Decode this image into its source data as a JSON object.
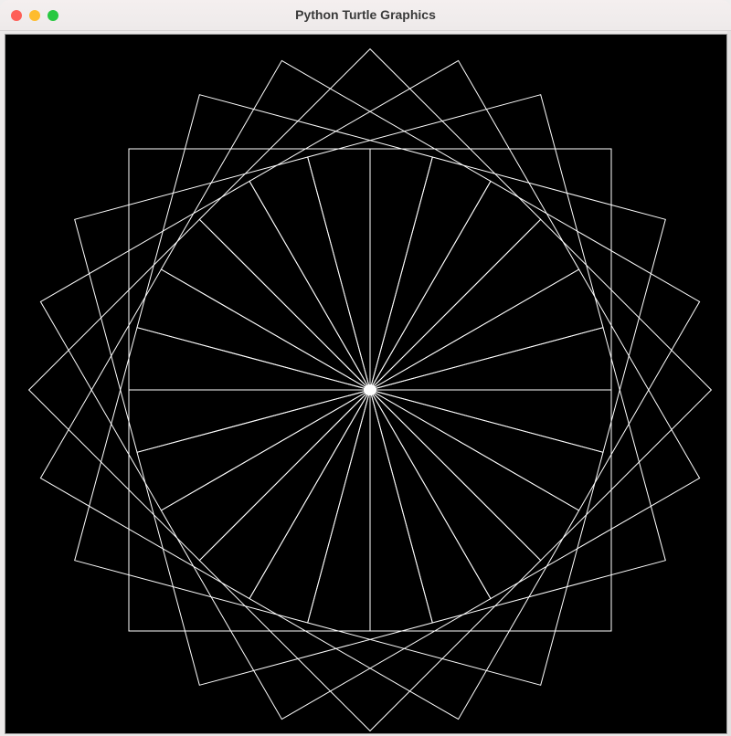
{
  "window": {
    "title": "Python Turtle Graphics"
  },
  "traffic_lights": {
    "close_color": "#fe5f57",
    "minimize_color": "#febc2e",
    "maximize_color": "#28c840"
  },
  "canvas": {
    "background_color": "#000000",
    "pen_color": "#ffffff",
    "drawing": "rotating-squares",
    "square_count": 24,
    "rotation_step_degrees": 15
  }
}
